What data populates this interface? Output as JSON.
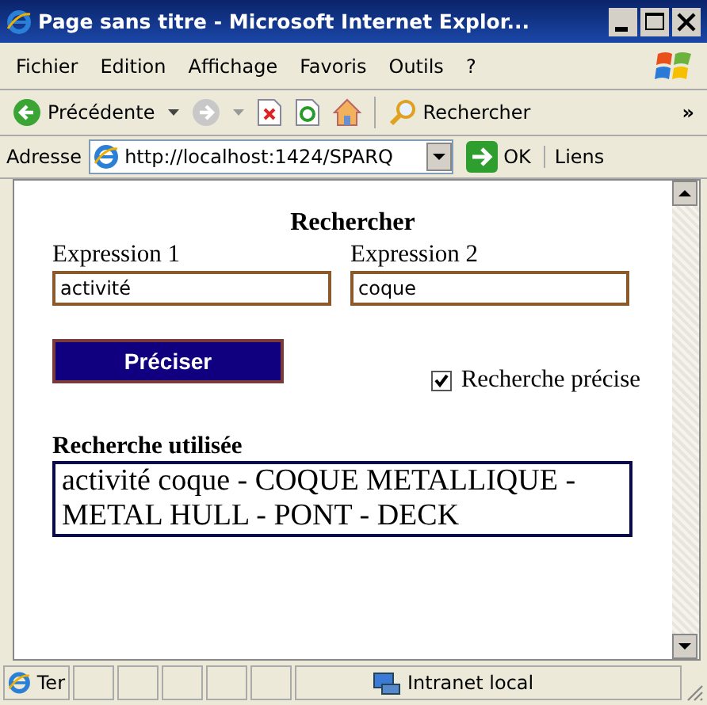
{
  "window": {
    "title": "Page sans titre - Microsoft Internet Explor..."
  },
  "menu": [
    {
      "label": "Fichier"
    },
    {
      "label": "Edition"
    },
    {
      "label": "Affichage"
    },
    {
      "label": "Favoris"
    },
    {
      "label": "Outils"
    },
    {
      "label": "?"
    }
  ],
  "toolbar": {
    "back_label": "Précédente",
    "forward_disabled": true,
    "search_label": "Rechercher",
    "more": "»"
  },
  "address_bar": {
    "label": "Adresse",
    "url": "http://localhost:1424/SPARQ",
    "go_label": "OK",
    "links_label": "Liens"
  },
  "form": {
    "title": "Rechercher",
    "fields": [
      {
        "label": "Expression 1",
        "value": "activité"
      },
      {
        "label": "Expression 2",
        "value": "coque"
      }
    ],
    "button": "Préciser",
    "checkbox": {
      "label": "Recherche précise",
      "checked": true
    },
    "result_title": "Recherche utilisée",
    "result_text": "activité coque - COQUE METALLIQUE - METAL HULL - PONT - DECK"
  },
  "status_bar": {
    "text": "Ter",
    "zone": "Intranet local"
  }
}
